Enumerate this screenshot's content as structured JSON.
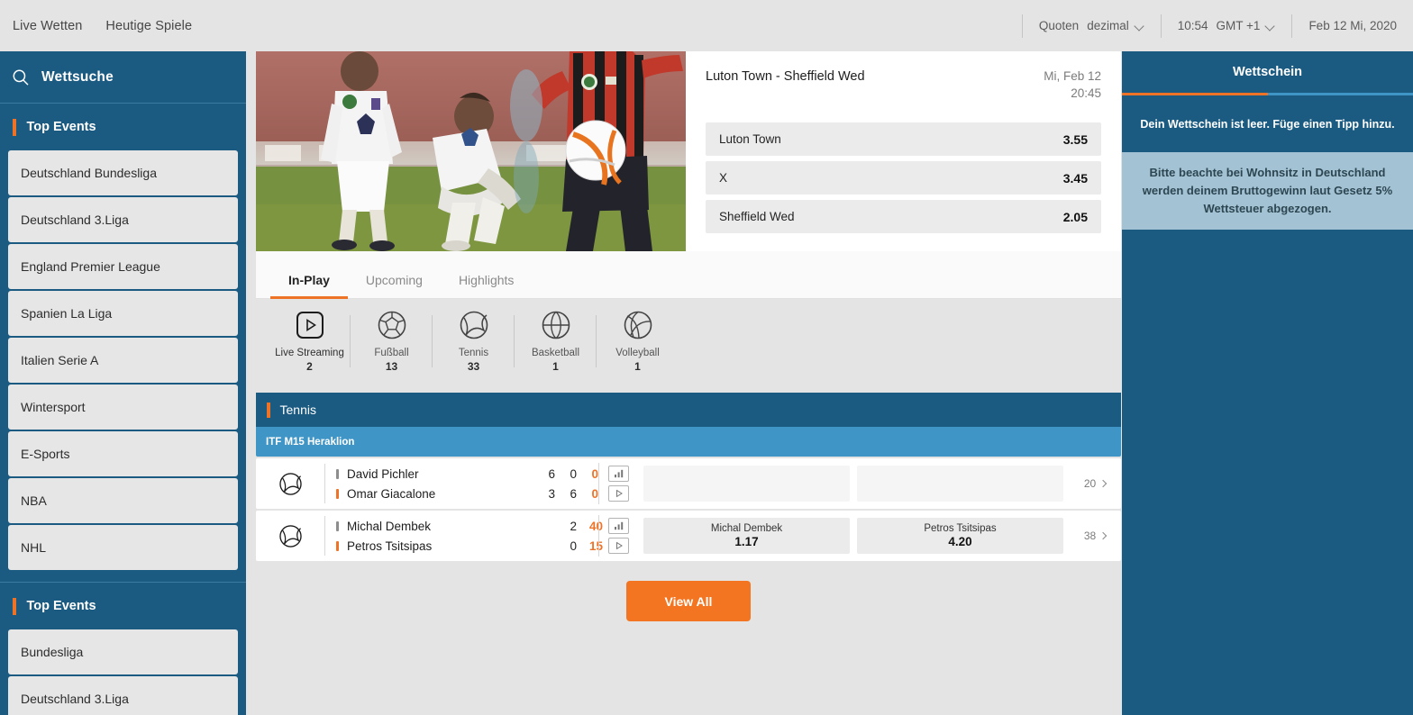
{
  "topnav": {
    "links": [
      {
        "label": "Live Wetten"
      },
      {
        "label": "Heutige Spiele"
      }
    ],
    "odds_format_label": "Quoten",
    "odds_format_value": "dezimal",
    "time": "10:54",
    "timezone": "GMT +1",
    "date": "Feb 12 Mi, 2020"
  },
  "sidebar": {
    "search_label": "Wettsuche",
    "sections": [
      {
        "title": "Top Events",
        "items": [
          {
            "label": "Deutschland Bundesliga"
          },
          {
            "label": "Deutschland 3.Liga"
          },
          {
            "label": "England Premier League"
          },
          {
            "label": "Spanien La Liga"
          },
          {
            "label": "Italien Serie A"
          },
          {
            "label": "Wintersport"
          },
          {
            "label": "E-Sports"
          },
          {
            "label": "NBA"
          },
          {
            "label": "NHL"
          }
        ]
      },
      {
        "title": "Top Events",
        "items": [
          {
            "label": "Bundesliga"
          },
          {
            "label": "Deutschland 3.Liga"
          }
        ]
      }
    ]
  },
  "feature": {
    "match_title": "Luton Town - Sheffield Wed",
    "date": "Mi, Feb 12",
    "time": "20:45",
    "odds": [
      {
        "name": "Luton Town",
        "value": "3.55"
      },
      {
        "name": "X",
        "value": "3.45"
      },
      {
        "name": "Sheffield Wed",
        "value": "2.05"
      }
    ]
  },
  "tabs": [
    {
      "label": "In-Play",
      "active": true
    },
    {
      "label": "Upcoming",
      "active": false
    },
    {
      "label": "Highlights",
      "active": false
    }
  ],
  "sports": [
    {
      "name": "Live Streaming",
      "count": "2",
      "icon": "live-streaming-icon"
    },
    {
      "name": "Fußball",
      "count": "13",
      "icon": "football-icon"
    },
    {
      "name": "Tennis",
      "count": "33",
      "icon": "tennis-icon"
    },
    {
      "name": "Basketball",
      "count": "1",
      "icon": "basketball-icon"
    },
    {
      "name": "Volleyball",
      "count": "1",
      "icon": "volleyball-icon"
    }
  ],
  "category": {
    "name": "Tennis",
    "league": "ITF M15 Heraklion",
    "matches": [
      {
        "players": [
          {
            "name": "David Pichler",
            "serving": false,
            "scores": [
              "6",
              "0"
            ],
            "points": "0"
          },
          {
            "name": "Omar Giacalone",
            "serving": true,
            "scores": [
              "3",
              "6"
            ],
            "points": "0"
          }
        ],
        "odds": [
          {
            "name": "",
            "value": "",
            "suspended": true
          },
          {
            "name": "",
            "value": "",
            "suspended": true
          }
        ],
        "more_count": "20"
      },
      {
        "players": [
          {
            "name": "Michal Dembek",
            "serving": false,
            "scores": [
              "2"
            ],
            "points": "40"
          },
          {
            "name": "Petros Tsitsipas",
            "serving": true,
            "scores": [
              "0"
            ],
            "points": "15"
          }
        ],
        "odds": [
          {
            "name": "Michal Dembek",
            "value": "1.17",
            "suspended": false
          },
          {
            "name": "Petros Tsitsipas",
            "value": "4.20",
            "suspended": false
          }
        ],
        "more_count": "38"
      }
    ]
  },
  "view_all_label": "View All",
  "slip": {
    "tab_label": "Wettschein",
    "empty_text": "Dein Wettschein ist leer. Füge einen Tipp hinzu.",
    "notice_text": "Bitte beachte bei Wohnsitz in Deutschland werden deinem Bruttogewinn laut Gesetz 5% Wettsteuer abgezogen."
  },
  "colors": {
    "brand_blue": "#1b5b82",
    "light_blue": "#3f95c6",
    "accent_orange": "#ef7326",
    "button_orange": "#f47521",
    "page_gray": "#e4e4e4"
  }
}
